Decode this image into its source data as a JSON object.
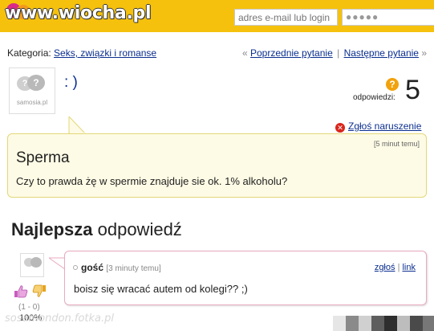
{
  "header": {
    "logo_text": "www.wiocha.pl",
    "email_placeholder": "adres e-mail lub login",
    "password_mask": "●●●●●",
    "brand_color": "#f5c10d"
  },
  "category": {
    "label": "Kategoria:",
    "value": "Seks, związki i romanse"
  },
  "nav": {
    "prev_arrow": "«",
    "prev": "Poprzednie pytanie",
    "separator": "|",
    "next": "Następne pytanie",
    "next_arrow": "»"
  },
  "question": {
    "avatar_label": "samosia.pl",
    "asker": ": )",
    "answers_label": "odpowiedzi:",
    "answers_count": "5",
    "report": "Zgłoś naruszenie",
    "time": "[5 minut temu]",
    "title": "Sperma",
    "body": "Czy to prawda żę w spermie znajduje sie ok. 1% alkoholu?"
  },
  "best_answer": {
    "heading_bold": "Najlepsza",
    "heading_rest": " odpowiedź",
    "author": "gość",
    "time": "[3 minuty temu]",
    "report_link": "zgłoś",
    "separator": "|",
    "link": "link",
    "text": "boisz się wracać autem od kolegi?? ;)",
    "votes": "(1 - 0)",
    "percent": "100%"
  },
  "watermark": {
    "bottom": "sosamondon.fotka.pl"
  }
}
